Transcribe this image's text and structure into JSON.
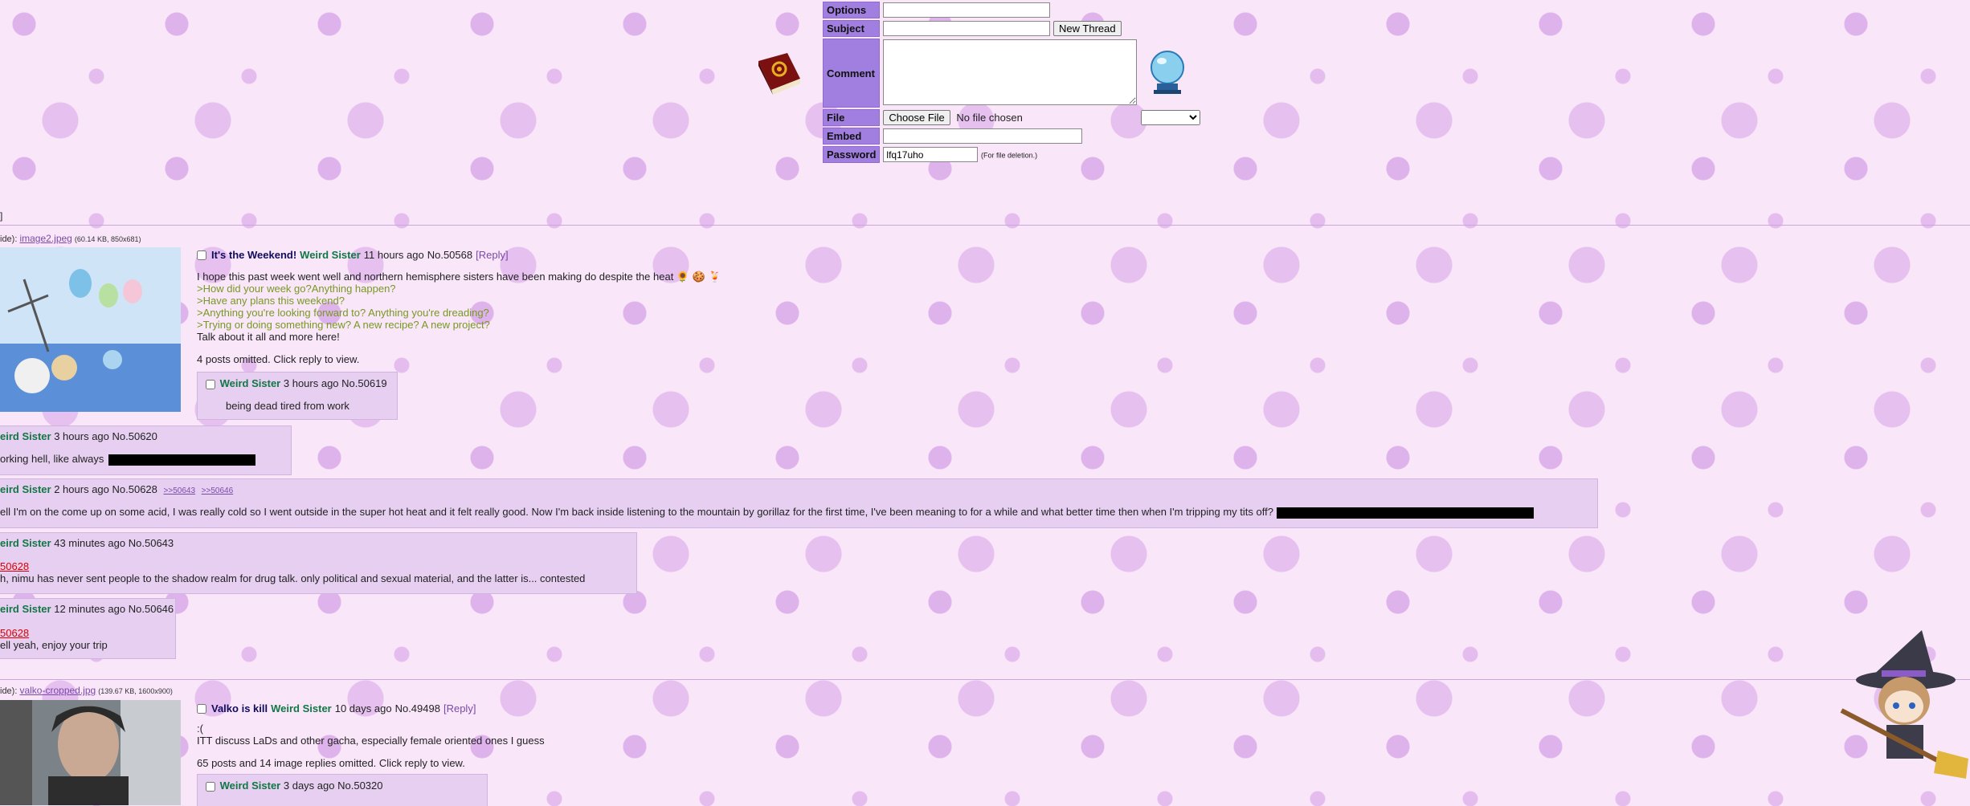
{
  "form": {
    "options_label": "Options",
    "subject_label": "Subject",
    "new_thread_button": "New Thread",
    "comment_label": "Comment",
    "file_label": "File",
    "choose_file_button": "Choose File",
    "file_status": "No file chosen",
    "embed_label": "Embed",
    "password_label": "Password",
    "password_value": "lfq17uho",
    "password_note": "(For file deletion.)"
  },
  "top_bracket": "]",
  "threads": [
    {
      "file_prefix": "ide):",
      "file_name": "image2.jpeg",
      "file_meta": "(60.14 KB, 850x681)",
      "subject": "It's the Weekend!",
      "name": "Weird Sister",
      "time": "11 hours ago",
      "no": "No.50568",
      "reply_link": "[Reply]",
      "body": [
        "I hope this past week went well and northern hemisphere sisters have been making do despite the heat 🌻 🍪 🍹"
      ],
      "greentext": [
        ">How did your week go?Anything happen?",
        ">Have any plans this weekend?",
        ">Anything you're looking forward to? Anything you're dreading?",
        ">Trying or doing something new? A new recipe? A new project?"
      ],
      "body_end": "Talk about it all and more here!",
      "omitted": "4 posts omitted. Click reply to view.",
      "replies": [
        {
          "name": "Weird Sister",
          "time": "3 hours ago",
          "no": "No.50619",
          "text": "being dead tired from work"
        },
        {
          "name": "eird Sister",
          "time": "3 hours ago",
          "no": "No.50620",
          "text": "orking hell, like always"
        },
        {
          "name": "eird Sister",
          "time": "2 hours ago",
          "no": "No.50628",
          "backlinks": [
            ">>50643",
            ">>50646"
          ],
          "text": "ell I'm on the come up on some acid, I was really cold so I went outside in the super hot heat and it felt really good. Now I'm back inside listening to the mountain by gorillaz for the first time, I've been meaning to for a while and what better time then when I'm tripping my tits off?"
        },
        {
          "name": "eird Sister",
          "time": "43 minutes ago",
          "no": "No.50643",
          "quote": "50628",
          "text": "h, nimu has never sent people to the shadow realm for drug talk. only political and sexual material, and the latter is... contested"
        },
        {
          "name": "eird Sister",
          "time": "12 minutes ago",
          "no": "No.50646",
          "quote": "50628",
          "text": "ell yeah, enjoy your trip"
        }
      ]
    },
    {
      "file_prefix": "ide):",
      "file_name": "valko-cropped.jpg",
      "file_meta": "(139.67 KB, 1600x900)",
      "subject": "Valko is kill",
      "name": "Weird Sister",
      "time": "10 days ago",
      "no": "No.49498",
      "reply_link": "[Reply]",
      "body": [
        ":(",
        "ITT discuss LaDs and other gacha, especially female oriented ones I guess"
      ],
      "omitted": "65 posts and 14 image replies omitted. Click reply to view.",
      "replies": [
        {
          "name": "Weird Sister",
          "time": "3 days ago",
          "no": "No.50320"
        }
      ]
    }
  ]
}
